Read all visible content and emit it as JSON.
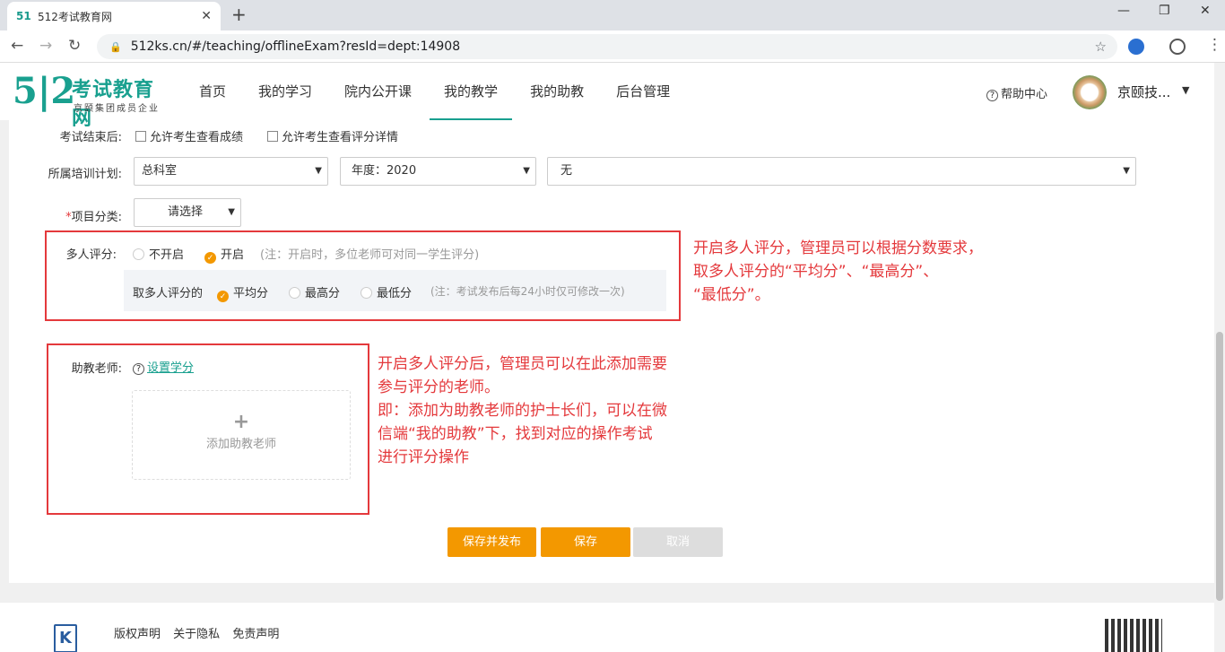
{
  "browser": {
    "tab_title": "512考试教育网",
    "url": "512ks.cn/#/teaching/offlineExam?resId=dept:14908"
  },
  "header": {
    "logo_name": "考试教育网",
    "logo_sub": "京颐集团成员企业",
    "nav": [
      "首页",
      "我的学习",
      "院内公开课",
      "我的教学",
      "我的助教",
      "后台管理"
    ],
    "active_nav": "我的教学",
    "help": "帮助中心",
    "user": "京颐技..."
  },
  "form": {
    "after_exam_label": "考试结束后:",
    "allow_score": "允许考生查看成绩",
    "allow_detail": "允许考生查看评分详情",
    "plan_label": "所属培训计划:",
    "plan_select": "总科室",
    "year_select": "年度：2020",
    "plan_item_select": "无",
    "category_label": "项目分类:",
    "category_required": "*",
    "category_select": "请选择",
    "multi_label": "多人评分:",
    "multi_off": "不开启",
    "multi_on": "开启",
    "multi_note": "(注：开启时，多位老师可对同一学生评分)",
    "take_label": "取多人评分的",
    "take_avg": "平均分",
    "take_max": "最高分",
    "take_min": "最低分",
    "take_note": "(注：考试发布后每24小时仅可修改一次)",
    "assistant_label": "助教老师:",
    "set_credit": "设置学分",
    "add_assistant": "添加助教老师"
  },
  "annotations": {
    "ann1": [
      "开启多人评分，管理员可以根据分数要求，",
      "取多人评分的“平均分”、“最高分”、",
      "“最低分”。"
    ],
    "ann2": [
      "开启多人评分后，管理员可以在此添加需要",
      "参与评分的老师。",
      "即：添加为助教老师的护士长们，可以在微",
      "信端“我的助教”下，找到对应的操作考试",
      "进行评分操作"
    ]
  },
  "buttons": {
    "save_publish": "保存并发布",
    "save": "保存",
    "cancel": "取消"
  },
  "footer": {
    "links": [
      "版权声明",
      "关于隐私",
      "免责声明"
    ]
  },
  "colors": {
    "brand": "#19a08f",
    "orange": "#f39800",
    "annotation_red": "#e4393c"
  }
}
